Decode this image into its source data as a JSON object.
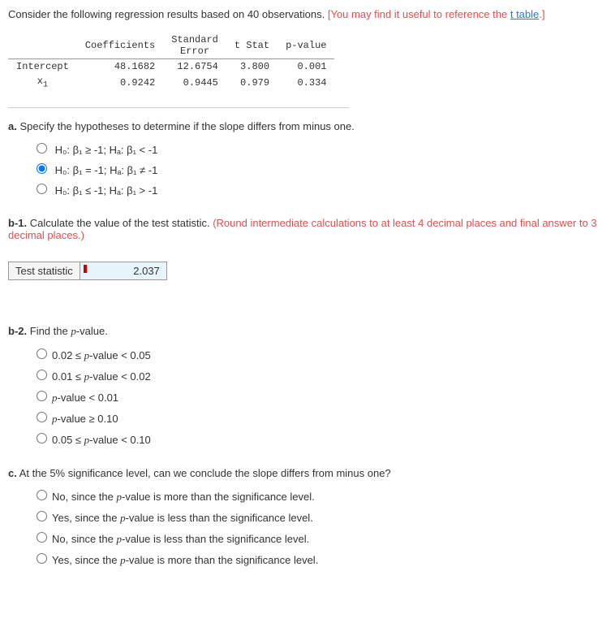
{
  "intro": {
    "text1": "Consider the following regression results based on 40 observations. ",
    "text2": "[You may find it useful to reference the ",
    "link": "t table",
    "text3": ".]"
  },
  "table": {
    "headers": {
      "coef": "Coefficients",
      "se": "Standard Error",
      "t": "t Stat",
      "p": "p-value"
    },
    "rows": [
      {
        "label": "Intercept",
        "coef": "48.1682",
        "se": "12.6754",
        "t": "3.800",
        "p": "0.001"
      },
      {
        "label": "x",
        "labelsub": "1",
        "coef": "0.9242",
        "se": "0.9445",
        "t": "0.979",
        "p": "0.334"
      }
    ]
  },
  "a": {
    "label": "a.",
    "text": " Specify the hypotheses to determine if the slope differs from minus one.",
    "options": [
      {
        "h0": "H₀: β₁ ≥ -1; Hₐ: β₁ < -1"
      },
      {
        "h0": "H₀: β₁ = -1; Hₐ: β₁ ≠ -1"
      },
      {
        "h0": "H₀: β₁ ≤ -1; Hₐ: β₁ > -1"
      }
    ]
  },
  "b1": {
    "label": "b-1.",
    "text": " Calculate the value of the test statistic. ",
    "red": "(Round intermediate calculations to at least 4 decimal places and final answer to 3 decimal places.)",
    "input_label": "Test statistic",
    "value": "2.037"
  },
  "b2": {
    "label": "b-2.",
    "text": " Find the p-value.",
    "options": [
      "0.02 ≤ p-value < 0.05",
      "0.01 ≤ p-value < 0.02",
      "p-value < 0.01",
      "p-value ≥ 0.10",
      "0.05 ≤ p-value < 0.10"
    ]
  },
  "c": {
    "label": "c.",
    "text": " At the 5% significance level, can we conclude the slope differs from minus one?",
    "options": [
      "No, since the p-value is more than the significance level.",
      "Yes, since the p-value is less than the significance level.",
      "No, since the p-value is less than the significance level.",
      "Yes, since the p-value is more than the significance level."
    ]
  }
}
